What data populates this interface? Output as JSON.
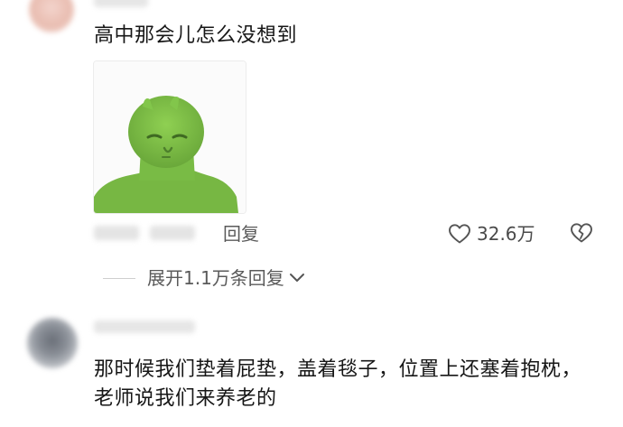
{
  "comments": [
    {
      "text": "高中那会儿怎么没想到",
      "has_sticker": true,
      "reply_label": "回复",
      "like_count": "32.6万",
      "expand_label": "展开1.1万条回复"
    },
    {
      "text": "那时候我们垫着屁垫，盖着毯子，位置上还塞着抱枕，老师说我们来养老的"
    }
  ],
  "icons": {
    "like": "heart-outline-icon",
    "dislike": "broken-heart-icon",
    "expand": "chevron-down-icon",
    "sticker": "green-creature-sticker"
  },
  "colors": {
    "text_primary": "#161616",
    "text_secondary": "#5a5a5a",
    "sticker_green": "#7bc043"
  }
}
